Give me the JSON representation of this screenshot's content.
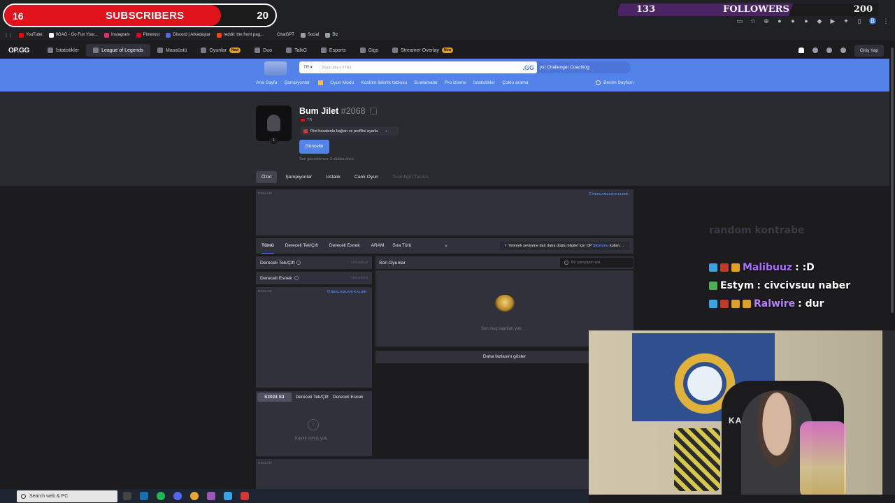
{
  "overlay": {
    "subscribers": {
      "current": "16",
      "label": "SUBSCRIBERS",
      "goal": "20",
      "progress": 0.8
    },
    "followers": {
      "current": "133",
      "label": "FOLLOWERS",
      "goal": "200",
      "progress": 0.665
    }
  },
  "bookmarks": [
    {
      "label": "YouTube",
      "color": "#ff0000"
    },
    {
      "label": "9GAG - Go Fun Your...",
      "color": "#ffffff"
    },
    {
      "label": "Instagram",
      "color": "#e1306c"
    },
    {
      "label": "Pinterest",
      "color": "#e60023"
    },
    {
      "label": "Discord | Arkadaşlar",
      "color": "#5865f2"
    },
    {
      "label": "reddit: the front pag...",
      "color": "#ff4500"
    },
    {
      "label": "ChatGPT",
      "color": "#222222"
    },
    {
      "label": "Social",
      "color": "#9aa0a6"
    },
    {
      "label": "Biz",
      "color": "#9aa0a6"
    }
  ],
  "opnav": {
    "logo": "OP.GG",
    "items": [
      {
        "label": "İstatistikler",
        "new": ""
      },
      {
        "label": "League of Legends",
        "new": ""
      },
      {
        "label": "Masaüstü",
        "new": ""
      },
      {
        "label": "Oyunlar",
        "new": "New"
      },
      {
        "label": "Duo",
        "new": ""
      },
      {
        "label": "TalkG",
        "new": ""
      },
      {
        "label": "Esports",
        "new": ""
      },
      {
        "label": "Gigs",
        "new": ""
      },
      {
        "label": "Streamer Overlay",
        "new": "New"
      }
    ],
    "login": "Giriş Yap"
  },
  "search": {
    "region": "TR",
    "placeholder": "Oyun adı + #TR1",
    "gg": ".GG",
    "promo": "ys! Challenger Coaching"
  },
  "subnav": {
    "items": [
      "Ana Sayfa",
      "Şampiyonlar",
      "Oyun Modu",
      "Kostüm liderlik tablosu",
      "Sıralamalar",
      "Pro izleme",
      "İstatistikler",
      "Çoklu arama"
    ],
    "my_page": "Benim Sayfam"
  },
  "profile": {
    "name": "Bum Jilet",
    "tag": "#2068",
    "region": "TR",
    "level": "1",
    "riot_link": "Riot hesabınla bağlan ve profilini ayarla.",
    "update": "Güncelle",
    "last_updated": "Son güncellenen: 2 dakika önce"
  },
  "tabs": [
    "Özet",
    "Şampiyonlar",
    "Ustalık",
    "Canlı Oyun",
    "Teamfight Tactics"
  ],
  "ads": {
    "label": "REKLAM",
    "remove": "REKLAMLARI KALDIR"
  },
  "filters": {
    "items": [
      "Tümü",
      "Dereceli Tek/Çift",
      "Dereceli Esnek",
      "ARAM"
    ],
    "queue_select": "Sıra Türü",
    "info_prefix": "Yetenek seviyene dair daha doğru bilgiler için OP",
    "info_link": "Skorunu",
    "info_suffix": "kullan."
  },
  "ranked": [
    {
      "label": "Dereceli Tek/Çift",
      "status": "Unranked"
    },
    {
      "label": "Dereceli Esnek",
      "status": "Unranked"
    }
  ],
  "season": {
    "tabs": [
      "S2024 S3",
      "Dereceli Tek/Çift",
      "Dereceli Esnek"
    ],
    "empty": "Kayıtlı sonuç yok."
  },
  "recent": {
    "title": "Son Oyunlar",
    "search_placeholder": "Bir şampiyon ara",
    "empty": "Son maç kayıtları yok.",
    "more": "Daha fazlasını göster"
  },
  "chat": {
    "faded": "random kontrabe",
    "lines": [
      {
        "user": "Malibuuz",
        "msg": ": :D",
        "color": "#a970ff"
      },
      {
        "user": "Estym",
        "msg": ": civcivsuu naber",
        "color": "#ffffff"
      },
      {
        "user": "Ralwire",
        "msg": ": dur",
        "color": "#b980ff"
      }
    ]
  },
  "webcam": {
    "chair_brand": "KAHRA"
  },
  "taskbar": {
    "search_placeholder": "Search web & PC"
  }
}
